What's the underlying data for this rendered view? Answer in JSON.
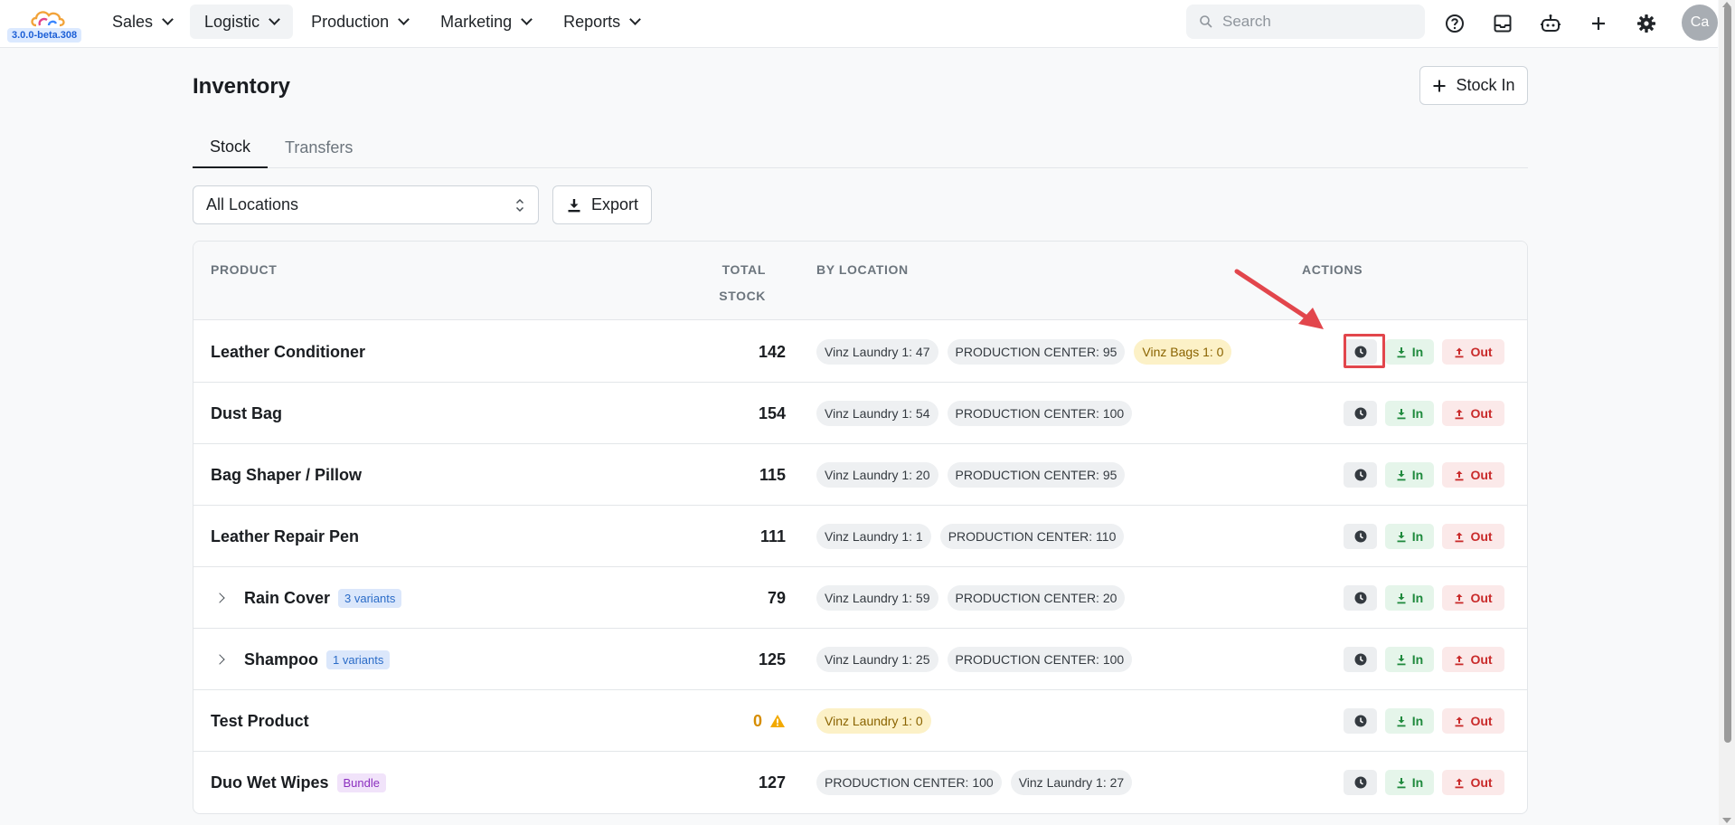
{
  "app": {
    "version": "3.0.0-beta.308",
    "user_initials": "Ca"
  },
  "nav": [
    {
      "label": "Sales",
      "active": false
    },
    {
      "label": "Logistic",
      "active": true
    },
    {
      "label": "Production",
      "active": false
    },
    {
      "label": "Marketing",
      "active": false
    },
    {
      "label": "Reports",
      "active": false
    }
  ],
  "search": {
    "placeholder": "Search",
    "value": ""
  },
  "toolbar_icons": [
    "help-icon",
    "inbox-icon",
    "bot-icon",
    "plus-icon",
    "gear-icon"
  ],
  "page": {
    "title": "Inventory",
    "stock_in_label": "Stock In",
    "tabs": [
      {
        "label": "Stock",
        "active": true
      },
      {
        "label": "Transfers",
        "active": false
      }
    ],
    "location_filter": "All Locations",
    "export_label": "Export"
  },
  "table": {
    "headers": {
      "product": "PRODUCT",
      "total_stock": "TOTAL STOCK",
      "by_location": "BY LOCATION",
      "actions": "ACTIONS"
    },
    "action_labels": {
      "in": "In",
      "out": "Out"
    },
    "rows": [
      {
        "name": "Leather Conditioner",
        "badge": "",
        "badge_type": "",
        "expandable": false,
        "total": "142",
        "warning": false,
        "locations": [
          {
            "label": "Vinz Laundry 1: 47",
            "zero": false
          },
          {
            "label": "PRODUCTION CENTER: 95",
            "zero": false
          },
          {
            "label": "Vinz Bags 1: 0",
            "zero": true
          }
        ]
      },
      {
        "name": "Dust Bag",
        "badge": "",
        "badge_type": "",
        "expandable": false,
        "total": "154",
        "warning": false,
        "locations": [
          {
            "label": "Vinz Laundry 1: 54",
            "zero": false
          },
          {
            "label": "PRODUCTION CENTER: 100",
            "zero": false
          }
        ]
      },
      {
        "name": "Bag Shaper / Pillow",
        "badge": "",
        "badge_type": "",
        "expandable": false,
        "total": "115",
        "warning": false,
        "locations": [
          {
            "label": "Vinz Laundry 1: 20",
            "zero": false
          },
          {
            "label": "PRODUCTION CENTER: 95",
            "zero": false
          }
        ]
      },
      {
        "name": "Leather Repair Pen",
        "badge": "",
        "badge_type": "",
        "expandable": false,
        "total": "111",
        "warning": false,
        "locations": [
          {
            "label": "Vinz Laundry 1: 1",
            "zero": false
          },
          {
            "label": "PRODUCTION CENTER: 110",
            "zero": false
          }
        ]
      },
      {
        "name": "Rain Cover",
        "badge": "3 variants",
        "badge_type": "variants",
        "expandable": true,
        "total": "79",
        "warning": false,
        "locations": [
          {
            "label": "Vinz Laundry 1: 59",
            "zero": false
          },
          {
            "label": "PRODUCTION CENTER: 20",
            "zero": false
          }
        ]
      },
      {
        "name": "Shampoo",
        "badge": "1 variants",
        "badge_type": "variants",
        "expandable": true,
        "total": "125",
        "warning": false,
        "locations": [
          {
            "label": "Vinz Laundry 1: 25",
            "zero": false
          },
          {
            "label": "PRODUCTION CENTER: 100",
            "zero": false
          }
        ]
      },
      {
        "name": "Test Product",
        "badge": "",
        "badge_type": "",
        "expandable": false,
        "total": "0",
        "warning": true,
        "locations": [
          {
            "label": "Vinz Laundry 1: 0",
            "zero": true
          }
        ]
      },
      {
        "name": "Duo Wet Wipes",
        "badge": "Bundle",
        "badge_type": "bundle",
        "expandable": false,
        "total": "127",
        "warning": false,
        "locations": [
          {
            "label": "PRODUCTION CENTER: 100",
            "zero": false
          },
          {
            "label": "Vinz Laundry 1: 27",
            "zero": false
          }
        ]
      }
    ]
  },
  "colors": {
    "accent": "#1a1d21",
    "in_green": "#1f8a3d",
    "out_red": "#c92a2a",
    "annotation_red": "#e2464c"
  }
}
